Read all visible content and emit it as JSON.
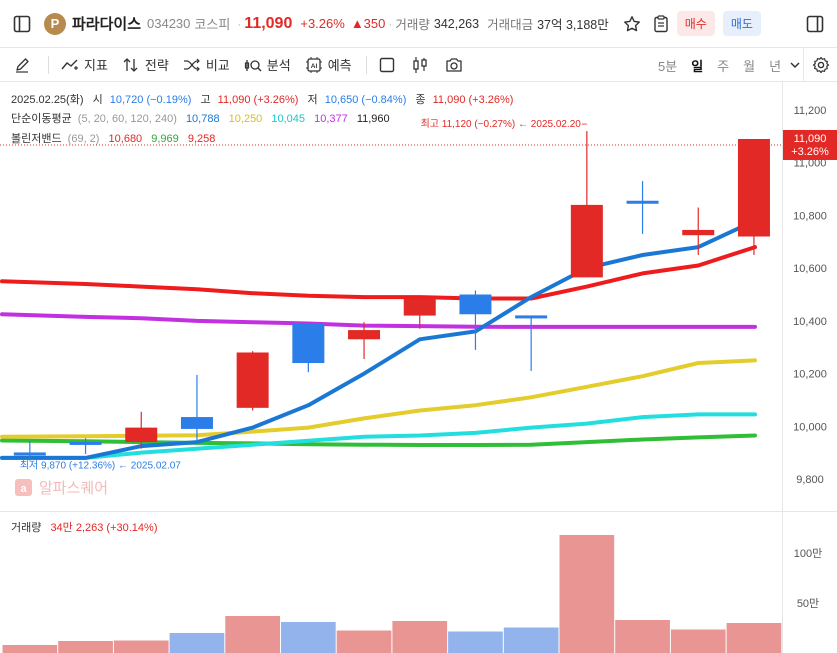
{
  "header": {
    "stock_logo_letter": "P",
    "stock_name": "파라다이스",
    "stock_code": "034230",
    "market": "코스피",
    "price": "11,090",
    "change_pct": "+3.26%",
    "change_abs": "▲350",
    "volume_label": "거래량",
    "volume_value": "342,263",
    "amount_label": "거래대금",
    "amount_value": "37억 3,188만",
    "buy_label": "매수",
    "sell_label": "매도"
  },
  "toolbar": {
    "indicator_label": "지표",
    "strategy_label": "전략",
    "compare_label": "비교",
    "analysis_label": "분석",
    "predict_label": "예측",
    "periods": [
      "5분",
      "일",
      "주",
      "월",
      "년"
    ],
    "active_period": "일"
  },
  "legend": {
    "date_line": {
      "date": "2025.02.25(화)",
      "open_label": "시",
      "open_value": "10,720 (−0.19%)",
      "high_label": "고",
      "high_value": "11,090 (+3.26%)",
      "low_label": "저",
      "low_value": "10,650 (−0.84%)",
      "close_label": "종",
      "close_value": "11,090 (+3.26%)"
    },
    "ma_line": {
      "label": "단순이동평균",
      "params": "(5, 20, 60, 120, 240)",
      "values": [
        "10,788",
        "10,250",
        "10,045",
        "10,377",
        "11,960"
      ]
    },
    "bb_line": {
      "label": "볼린저밴드",
      "params": "(69, 2)",
      "values": [
        "10,680",
        "9,969",
        "9,258"
      ]
    },
    "high_annotation": "최고 11,120 (−0.27%) ← 2025.02.20",
    "low_annotation": "최저 9,870 (+12.36%) ← 2025.02.07",
    "volume_label": "거래량",
    "volume_value": "34만 2,263 (+30.14%)"
  },
  "watermark": "알파스퀘어",
  "colors": {
    "up": "#e22926",
    "down": "#2b7de9",
    "ma5": "#1a78d4",
    "ma20": "#e4cc2c",
    "ma60": "#22dede",
    "ma120": "#c231e0",
    "ma240": "#2fbf36",
    "bb_upper": "#ee1c1c",
    "vol_up": "#e89594",
    "vol_down": "#93b3ec"
  },
  "chart_data": {
    "type": "candlestick",
    "price_axis": {
      "ylim": [
        9750,
        11300
      ],
      "ticks": [
        9800,
        10000,
        10200,
        10400,
        10600,
        10800,
        11000,
        11200
      ],
      "tick_labels": [
        "9,800",
        "10,000",
        "10,200",
        "10,400",
        "10,600",
        "10,800",
        "11,000",
        "11,200"
      ]
    },
    "current_price": {
      "label": "11,090",
      "change": "+3.26%",
      "value": 11090
    },
    "candles": [
      {
        "o": 9895,
        "h": 9945,
        "l": 9870,
        "c": 9895
      },
      {
        "o": 9935,
        "h": 9955,
        "l": 9895,
        "c": 9935
      },
      {
        "o": 9940,
        "h": 10055,
        "l": 9915,
        "c": 9995
      },
      {
        "o": 10035,
        "h": 10195,
        "l": 9945,
        "c": 9990
      },
      {
        "o": 10070,
        "h": 10285,
        "l": 10060,
        "c": 10280
      },
      {
        "o": 10390,
        "h": 10390,
        "l": 10205,
        "c": 10240
      },
      {
        "o": 10330,
        "h": 10395,
        "l": 10255,
        "c": 10365
      },
      {
        "o": 10420,
        "h": 10480,
        "l": 10370,
        "c": 10485
      },
      {
        "o": 10500,
        "h": 10515,
        "l": 10290,
        "c": 10425
      },
      {
        "o": 10415,
        "h": 10415,
        "l": 10210,
        "c": 10405
      },
      {
        "o": 10565,
        "h": 11120,
        "l": 10565,
        "c": 10840
      },
      {
        "o": 10850,
        "h": 10930,
        "l": 10730,
        "c": 10850
      },
      {
        "o": 10725,
        "h": 10830,
        "l": 10650,
        "c": 10745
      },
      {
        "o": 10720,
        "h": 11090,
        "l": 10650,
        "c": 11090
      }
    ],
    "ma_series": [
      {
        "key": "ma5",
        "values": [
          9880,
          9880,
          9925,
          9940,
          9995,
          10080,
          10200,
          10330,
          10360,
          10490,
          10600,
          10650,
          10680,
          10780
        ]
      },
      {
        "key": "ma20",
        "values": [
          9960,
          9962,
          9964,
          9966,
          9980,
          9995,
          10030,
          10060,
          10080,
          10110,
          10150,
          10190,
          10240,
          10250
        ]
      },
      {
        "key": "ma60",
        "values": [
          9880,
          9880,
          9900,
          9915,
          9930,
          9945,
          9960,
          9965,
          9975,
          9995,
          10010,
          10035,
          10045,
          10045
        ]
      },
      {
        "key": "ma120",
        "values": [
          10425,
          10415,
          10410,
          10400,
          10395,
          10390,
          10382,
          10380,
          10378,
          10377,
          10377,
          10377,
          10377,
          10377
        ]
      },
      {
        "key": "ma240",
        "values": [
          9946,
          9943,
          9940,
          9937,
          9935,
          9932,
          9930,
          9929,
          9929,
          9930,
          9940,
          9950,
          9958,
          9965
        ]
      }
    ],
    "bb_upper": [
      10550,
      10540,
      10530,
      10520,
      10505,
      10495,
      10490,
      10490,
      10485,
      10485,
      10530,
      10580,
      10610,
      10680
    ],
    "volume_axis": {
      "ylim": [
        0,
        1250000
      ],
      "ticks": [
        500000,
        1000000
      ],
      "tick_labels": [
        "50만",
        "100만"
      ]
    },
    "volume": [
      80000,
      120000,
      125000,
      200000,
      370000,
      310000,
      225000,
      320000,
      215000,
      255000,
      1180000,
      330000,
      235000,
      300000
    ]
  }
}
